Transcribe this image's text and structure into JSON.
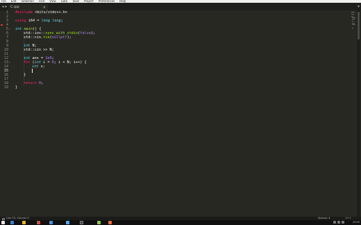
{
  "menu": [
    "File",
    "Edit",
    "Selection",
    "Find",
    "View",
    "Goto",
    "Tools",
    "Project",
    "Preferences",
    "Help"
  ],
  "tabs": [
    {
      "name": "C.cpp",
      "active": true
    }
  ],
  "editor": {
    "line_numbers": [
      "1",
      "2",
      "3",
      "4",
      "5",
      "6",
      "7",
      "8",
      "9",
      "10",
      "11",
      "12",
      "13",
      "14",
      "15",
      "16",
      "17",
      "18",
      "19"
    ],
    "active_line": "15",
    "lines": {
      "l1_pp": "#include",
      "l1_rest": " <bits/stdc++.h>",
      "l3_kw": "using",
      "l3_rest": " i64 = ",
      "l3_ty": "long long",
      "l3_end": ";",
      "l5_ty": "int",
      "l5_fn": " main",
      "l5_rest": "() {",
      "l6_a": "std::ios::",
      "l6_fn": "sync_with_stdio",
      "l6_b": "(",
      "l6_num": "false",
      "l6_c": ");",
      "l7_a": "std::cin.",
      "l7_fn": "tie",
      "l7_b": "(",
      "l7_num": "nullptr",
      "l7_c": ");",
      "l9_ty": "int",
      "l9_rest": " N;",
      "l10": "std::cin >> N;",
      "l12_ty": "int",
      "l12_rest": " ans = ",
      "l12_num": "1e9",
      "l12_end": ";",
      "l13_kw": "for",
      "l13_a": " (",
      "l13_ty": "int",
      "l13_b": " i = ",
      "l13_num": "0",
      "l13_c": "; i < N; i++) {",
      "l14_ty": "int",
      "l14_rest": " x;",
      "l16": "}",
      "l18_kw": "return",
      "l18_num": " 0",
      "l18_end": ";",
      "l19": "}"
    }
  },
  "status": {
    "position": "Line 15, Column 9",
    "indent": "Spaces: 4",
    "syntax": "C++"
  },
  "taskbar": {
    "clock": "23:05"
  },
  "colors": {
    "background": "#272822",
    "keyword": "#f92672",
    "type": "#66d9ef",
    "function": "#a6e22e",
    "number": "#ae81ff",
    "text": "#f8f8f2"
  }
}
